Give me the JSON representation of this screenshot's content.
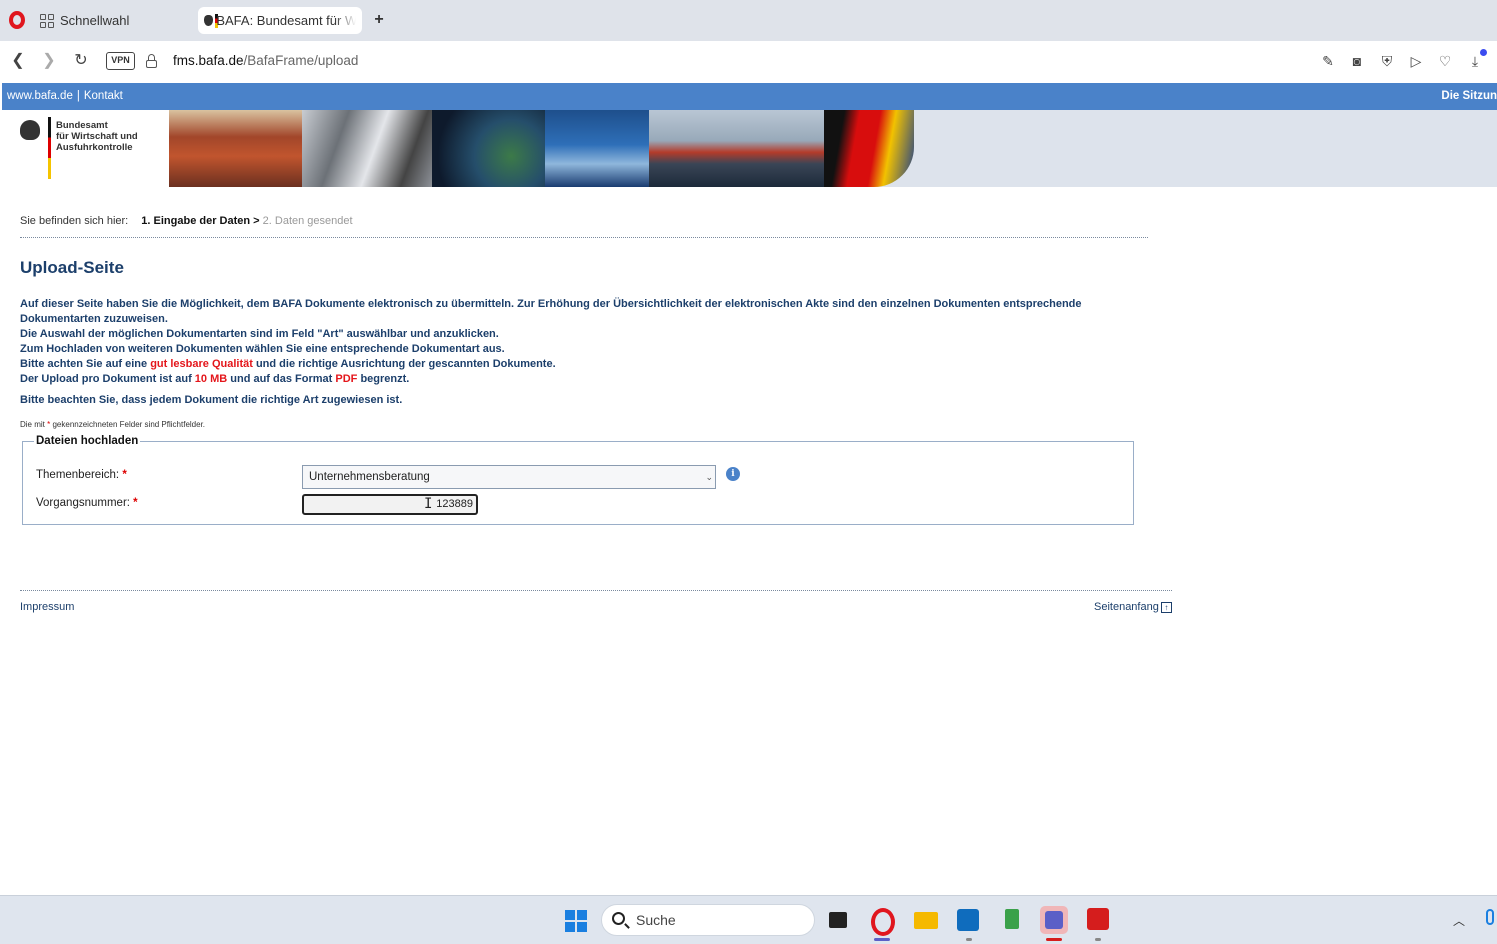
{
  "browser": {
    "tabs": [
      {
        "label": "Schnellwahl"
      },
      {
        "label": "BAFA: Bundesamt für Wirtschaft und Ausfuhrkontrolle"
      }
    ],
    "new_tab": "+",
    "vpn_label": "VPN",
    "url_host": "fms.bafa.de",
    "url_path": "/BafaFrame/upload"
  },
  "site": {
    "toplinks": {
      "home": "www.bafa.de",
      "sep": "|",
      "contact": "Kontakt"
    },
    "session_text": "Die Sitzun",
    "logo_lines": [
      "Bundesamt",
      "für Wirtschaft und",
      "Ausfuhrkontrolle"
    ]
  },
  "breadcrumb": {
    "prefix": "Sie befinden sich hier:",
    "current": "1. Eingabe der Daten >",
    "next": "2. Daten gesendet"
  },
  "page_title": "Upload-Seite",
  "intro": {
    "p1": "Auf dieser Seite haben Sie die Möglichkeit, dem BAFA Dokumente elektronisch zu übermitteln. Zur Erhöhung der Übersichtlichkeit der elektronischen Akte sind den einzelnen Dokumenten entsprechende Dokumentarten zuzuweisen.",
    "p2": "Die Auswahl der möglichen Dokumentarten sind im Feld \"Art\" auswählbar und anzuklicken.",
    "p3": "Zum Hochladen von weiteren Dokumenten wählen Sie eine entsprechende Dokumentart aus.",
    "p4_a": "Bitte achten Sie auf eine ",
    "p4_red": "gut lesbare Qualität",
    "p4_b": " und die richtige Ausrichtung der gescannten Dokumente.",
    "p5_a": "Der Upload pro Dokument ist auf ",
    "p5_red1": "10 MB",
    "p5_b": " und auf das Format ",
    "p5_red2": "PDF",
    "p5_c": " begrenzt.",
    "p6": "Bitte beachten Sie, dass jedem Dokument die richtige Art zugewiesen ist."
  },
  "required_note": {
    "a": "Die mit ",
    "star": "*",
    "b": " gekennzeichneten Felder sind Pflichtfelder."
  },
  "form": {
    "legend": "Dateien hochladen",
    "topic_label": "Themenbereich:",
    "topic_value": "Unternehmensberatung",
    "case_label": "Vorgangsnummer:",
    "case_value": "123889",
    "required_star": "*",
    "info_glyph": "i"
  },
  "footer": {
    "imprint": "Impressum",
    "top": "Seitenanfang"
  },
  "taskbar": {
    "search_label": "Suche"
  }
}
